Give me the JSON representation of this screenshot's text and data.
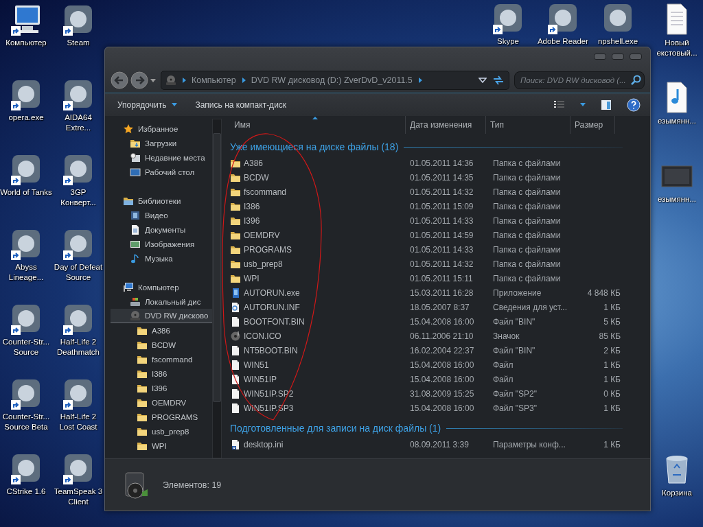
{
  "desktop": {
    "left_icons": [
      {
        "label": "Компьютер",
        "kind": "computer",
        "shortcut": true
      },
      {
        "label": "Steam",
        "kind": "app",
        "shortcut": true
      },
      {
        "label": "opera.exe",
        "kind": "app",
        "shortcut": true
      },
      {
        "label": "AIDA64 Extre...",
        "kind": "app",
        "shortcut": true
      },
      {
        "label": "World of Tanks",
        "kind": "app",
        "shortcut": true
      },
      {
        "label": "3GP Конверт...",
        "kind": "app",
        "shortcut": true
      },
      {
        "label": "Abyss Lineage...",
        "kind": "app",
        "shortcut": true
      },
      {
        "label": "Day of Defeat Source",
        "kind": "app",
        "shortcut": true
      },
      {
        "label": "Counter-Str... Source",
        "kind": "app",
        "shortcut": true
      },
      {
        "label": "Half-Life 2 Deathmatch",
        "kind": "app",
        "shortcut": true
      },
      {
        "label": "Counter-Str... Source Beta",
        "kind": "app",
        "shortcut": true
      },
      {
        "label": "Half-Life 2 Lost Coast",
        "kind": "app",
        "shortcut": true
      },
      {
        "label": "CStrike 1.6",
        "kind": "app",
        "shortcut": true
      },
      {
        "label": "TeamSpeak 3 Client",
        "kind": "app",
        "shortcut": true
      }
    ],
    "top_icons": [
      {
        "label": "Skype",
        "kind": "app",
        "shortcut": true
      },
      {
        "label": "Adobe Reader",
        "kind": "app",
        "shortcut": true
      },
      {
        "label": "npshell.exe",
        "kind": "app",
        "shortcut": false
      }
    ],
    "right_icons": [
      {
        "label": "Новый екстовый...",
        "kind": "document",
        "shortcut": false
      },
      {
        "label": "езымянн...",
        "kind": "audio",
        "shortcut": false
      },
      {
        "label": "езымянн...",
        "kind": "picture",
        "shortcut": false
      }
    ],
    "bottom_icons": [
      {
        "label": "Корзина",
        "kind": "trash",
        "shortcut": false
      }
    ]
  },
  "window": {
    "address": {
      "crumbs": [
        "Компьютер",
        "DVD RW дисковод (D:) ZverDvD_v2011.5"
      ]
    },
    "search": {
      "placeholder": "Поиск: DVD RW дисковод (..."
    },
    "toolbar": {
      "buttons": [
        {
          "label": "Упорядочить",
          "menu": true
        },
        {
          "label": "Запись на компакт-диск",
          "menu": false
        }
      ]
    },
    "sidebar": {
      "sections": [
        {
          "label": "Избранное",
          "kind": "star",
          "selected": false,
          "children": [
            {
              "label": "Загрузки",
              "kind": "downloads",
              "selected": false
            },
            {
              "label": "Недавние места",
              "kind": "recent",
              "selected": false
            },
            {
              "label": "Рабочий стол",
              "kind": "desktop",
              "selected": false
            }
          ]
        },
        {
          "label": "Библиотеки",
          "kind": "libraries",
          "selected": false,
          "children": [
            {
              "label": "Видео",
              "kind": "video",
              "selected": false
            },
            {
              "label": "Документы",
              "kind": "documents",
              "selected": false
            },
            {
              "label": "Изображения",
              "kind": "pictures",
              "selected": false
            },
            {
              "label": "Музыка",
              "kind": "music",
              "selected": false
            }
          ]
        },
        {
          "label": "Компьютер",
          "kind": "computer",
          "selected": false,
          "children": [
            {
              "label": "Локальный дис",
              "kind": "disk",
              "selected": false
            },
            {
              "label": "DVD RW дисково",
              "kind": "dvd",
              "selected": true,
              "children": [
                {
                  "label": "A386",
                  "kind": "folder",
                  "selected": false
                },
                {
                  "label": "BCDW",
                  "kind": "folder",
                  "selected": false
                },
                {
                  "label": "fscommand",
                  "kind": "folder",
                  "selected": false
                },
                {
                  "label": "I386",
                  "kind": "folder",
                  "selected": false
                },
                {
                  "label": "I396",
                  "kind": "folder",
                  "selected": false
                },
                {
                  "label": "OEMDRV",
                  "kind": "folder",
                  "selected": false
                },
                {
                  "label": "PROGRAMS",
                  "kind": "folder",
                  "selected": false
                },
                {
                  "label": "usb_prep8",
                  "kind": "folder",
                  "selected": false
                },
                {
                  "label": "WPI",
                  "kind": "folder",
                  "selected": false
                }
              ]
            }
          ]
        }
      ]
    },
    "columns": [
      {
        "label": "Имя",
        "sorted": true
      },
      {
        "label": "Дата изменения",
        "sorted": false
      },
      {
        "label": "Тип",
        "sorted": false
      },
      {
        "label": "Размер",
        "sorted": false
      }
    ],
    "groups": [
      {
        "title": "Уже имеющиеся на диске файлы (18)",
        "files": [
          {
            "name": "A386",
            "kind": "folder",
            "date": "01.05.2011 14:36",
            "type": "Папка с файлами"
          },
          {
            "name": "BCDW",
            "kind": "folder",
            "date": "01.05.2011 14:35",
            "type": "Папка с файлами"
          },
          {
            "name": "fscommand",
            "kind": "folder",
            "date": "01.05.2011 14:32",
            "type": "Папка с файлами"
          },
          {
            "name": "I386",
            "kind": "folder",
            "date": "01.05.2011 15:09",
            "type": "Папка с файлами"
          },
          {
            "name": "I396",
            "kind": "folder",
            "date": "01.05.2011 14:33",
            "type": "Папка с файлами"
          },
          {
            "name": "OEMDRV",
            "kind": "folder",
            "date": "01.05.2011 14:59",
            "type": "Папка с файлами"
          },
          {
            "name": "PROGRAMS",
            "kind": "folder",
            "date": "01.05.2011 14:33",
            "type": "Папка с файлами"
          },
          {
            "name": "usb_prep8",
            "kind": "folder",
            "date": "01.05.2011 14:32",
            "type": "Папка с файлами"
          },
          {
            "name": "WPI",
            "kind": "folder",
            "date": "01.05.2011 15:11",
            "type": "Папка с файлами"
          },
          {
            "name": "AUTORUN.exe",
            "kind": "exe",
            "date": "15.03.2011 16:28",
            "type": "Приложение",
            "size": "4 848 КБ"
          },
          {
            "name": "AUTORUN.INF",
            "kind": "inf",
            "date": "18.05.2007 8:37",
            "type": "Сведения для уст...",
            "size": "1 КБ"
          },
          {
            "name": "BOOTFONT.BIN",
            "kind": "file",
            "date": "15.04.2008 16:00",
            "type": "Файл \"BIN\"",
            "size": "5 КБ"
          },
          {
            "name": "ICON.ICO",
            "kind": "ico",
            "date": "06.11.2006 21:10",
            "type": "Значок",
            "size": "85 КБ"
          },
          {
            "name": "NT5BOOT.BIN",
            "kind": "file",
            "date": "16.02.2004 22:37",
            "type": "Файл \"BIN\"",
            "size": "2 КБ"
          },
          {
            "name": "WIN51",
            "kind": "file",
            "date": "15.04.2008 16:00",
            "type": "Файл",
            "size": "1 КБ"
          },
          {
            "name": "WIN51IP",
            "kind": "file",
            "date": "15.04.2008 16:00",
            "type": "Файл",
            "size": "1 КБ"
          },
          {
            "name": "WIN51IP.SP2",
            "kind": "file",
            "date": "31.08.2009 15:25",
            "type": "Файл \"SP2\"",
            "size": "0 КБ"
          },
          {
            "name": "WIN51IP.SP3",
            "kind": "file",
            "date": "15.04.2008 16:00",
            "type": "Файл \"SP3\"",
            "size": "1 КБ"
          }
        ]
      },
      {
        "title": "Подготовленные для записи на диск файлы (1)",
        "files": [
          {
            "name": "desktop.ini",
            "kind": "ini",
            "date": "08.09.2011 3:39",
            "type": "Параметры конф...",
            "size": "1 КБ"
          }
        ]
      }
    ],
    "status_bar": {
      "text": "Элементов: 19"
    }
  },
  "annotation": {
    "kind": "ellipse"
  }
}
